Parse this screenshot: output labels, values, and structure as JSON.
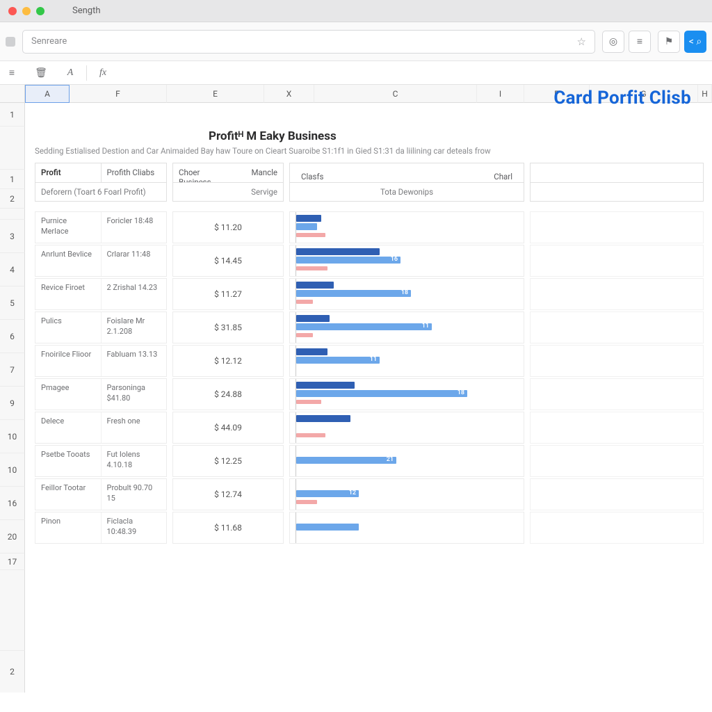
{
  "titlebar": {
    "title": "Sength"
  },
  "addrbar": {
    "placeholder": "Senreare"
  },
  "sheet": {
    "cols": [
      "A",
      "F",
      "E",
      "X",
      "C",
      "I",
      "F",
      "G",
      "H"
    ],
    "selCol": "A",
    "rowLabels": [
      "1",
      "",
      "1",
      "2",
      "",
      "3",
      "4",
      "5",
      "6",
      "7",
      "9",
      "10",
      "10",
      "16",
      "20",
      "17",
      "",
      "2"
    ]
  },
  "bigtitle": "Card Porfit Clisb",
  "section": {
    "title": "Profitᴴ M Eaky Business",
    "sub": "Sedding Estialised Destion and Car Animaided Bay haw Toure on Cieart Suaroibe S1:1f1 in Gied S1:31 da liilining car deteals frow"
  },
  "h1": {
    "profit": "Profit",
    "clabs": "Profith Cliabs"
  },
  "h2": {
    "biz": "Choer Business",
    "mancle": "Mancle"
  },
  "h3": {
    "l": "Clasfs",
    "r": "Charl"
  },
  "sub1": "Deforern (Toart 6 Foarl Profit)",
  "sub2": "Servige",
  "sub3": "Tota Dewonips",
  "rows": [
    {
      "c1": "Purnice Merlace",
      "c2": "Foricler 18:48",
      "amt": "$ 11.20"
    },
    {
      "c1": "Anrlunt Bevlice",
      "c2": "Crlarar 11:48",
      "amt": "$ 14.45"
    },
    {
      "c1": "Revice Firoet",
      "c2": "2 Zrishal 14.23",
      "amt": "$ 11.27"
    },
    {
      "c1": "Pulics",
      "c2": "Foislare Mr 2.1.208",
      "amt": "$ 31.85"
    },
    {
      "c1": "Fnoirilce Flioor",
      "c2": "Fabluam 13.13",
      "amt": "$ 12.12"
    },
    {
      "c1": "Pmagee",
      "c2": "Parsoninga $41.80",
      "amt": "$ 24.88"
    },
    {
      "c1": "Delece",
      "c2": "Fresh one",
      "amt": "$ 44.09"
    },
    {
      "c1": "Psetbe Tooats",
      "c2": "Fut Iolens 4.10.18",
      "amt": "$ 12.25"
    },
    {
      "c1": "Feillor Tootar",
      "c2": "Probult 90.70 15",
      "amt": "$ 12.74"
    },
    {
      "c1": "Pinon",
      "c2": "Ficlacla 10:48.39",
      "amt": "$ 11.68"
    }
  ],
  "chart_data": {
    "type": "bar",
    "orientation": "horizontal",
    "categories": [
      "Purnice Merlace",
      "Anrlunt Bevlice",
      "Revice Firoet",
      "Pulics",
      "Fnoirilce Flioor",
      "Pmagee",
      "Delece",
      "Psetbe Tooats",
      "Feillor Tootar",
      "Pinon"
    ],
    "xlim": [
      0,
      100
    ],
    "series": [
      {
        "name": "dark",
        "color": "#2f5fb3",
        "values": [
          12,
          40,
          18,
          16,
          15,
          28,
          26,
          0,
          0,
          0
        ]
      },
      {
        "name": "light",
        "color": "#6ca7ea",
        "values": [
          10,
          50,
          55,
          65,
          40,
          82,
          0,
          48,
          30,
          30
        ],
        "labels": [
          "",
          "16",
          "18",
          "11",
          "11",
          "18",
          "",
          "21",
          "12",
          ""
        ]
      },
      {
        "name": "pink",
        "color": "#f3a8a8",
        "values": [
          14,
          15,
          8,
          8,
          0,
          12,
          14,
          0,
          10,
          0
        ]
      }
    ]
  }
}
